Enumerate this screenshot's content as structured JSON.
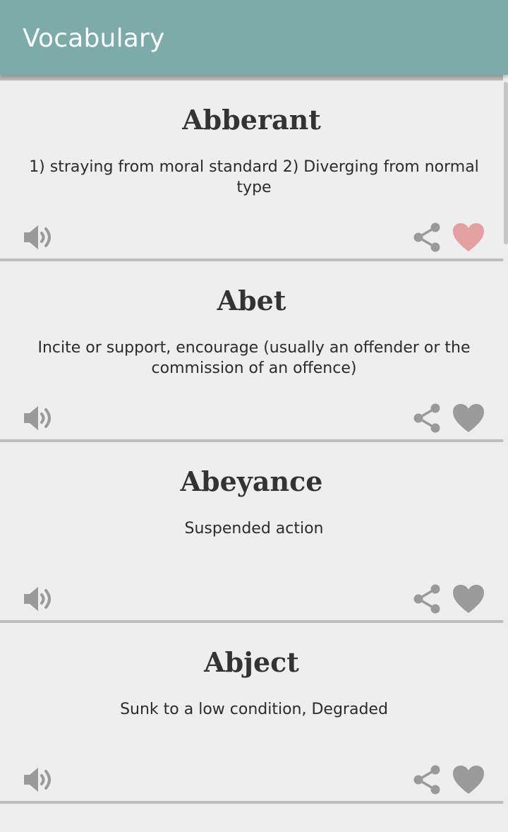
{
  "app_bar": {
    "title": "Vocabulary"
  },
  "colors": {
    "app_bar": "#7dabaa",
    "card_background": "#edeeed",
    "icon_gray": "#9a9a9a",
    "favorite_active": "#e3a0a0"
  },
  "words": [
    {
      "word": "Abberant",
      "meaning": "1) straying from moral standard 2) Diverging from normal type",
      "favorite": true,
      "speaker_icon": "speaker-icon",
      "share_icon": "share-icon",
      "favorite_icon": "heart-icon"
    },
    {
      "word": "Abet",
      "meaning": "Incite or support, encourage (usually an offender or the commission of an offence)",
      "favorite": false,
      "speaker_icon": "speaker-icon",
      "share_icon": "share-icon",
      "favorite_icon": "heart-icon"
    },
    {
      "word": "Abeyance",
      "meaning": "Suspended action",
      "favorite": false,
      "speaker_icon": "speaker-icon",
      "share_icon": "share-icon",
      "favorite_icon": "heart-icon"
    },
    {
      "word": "Abject",
      "meaning": "Sunk to a low condition, Degraded",
      "favorite": false,
      "speaker_icon": "speaker-icon",
      "share_icon": "share-icon",
      "favorite_icon": "heart-icon"
    }
  ]
}
